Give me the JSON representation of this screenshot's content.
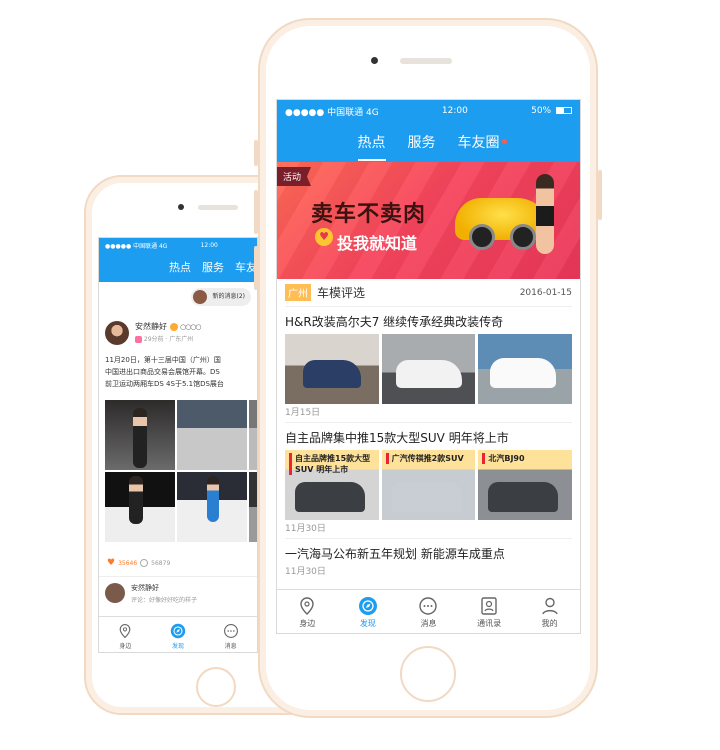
{
  "front": {
    "status": {
      "carrier": "●●●●● 中国联通 4G",
      "time": "12:00",
      "battery": "50%"
    },
    "nav": {
      "tabs": [
        "热点",
        "服务",
        "车友圈"
      ]
    },
    "banner": {
      "tag": "活动",
      "title": "卖车不卖肉",
      "subtitle": "投我就知道"
    },
    "section": {
      "tag": "广州",
      "title": "车模评选",
      "date": "2016-01-15"
    },
    "articles": [
      {
        "title": "H&R改装高尔夫7 继续传承经典改装传奇",
        "date": "1月15日",
        "captions": [
          "",
          "",
          ""
        ]
      },
      {
        "title": "自主品牌集中推15款大型SUV 明年将上市",
        "date": "11月30日",
        "captions": [
          "自主品牌推15款大型SUV 明年上市",
          "广汽传祺推2款SUV",
          "北汽BJ90"
        ]
      },
      {
        "title": "一汽海马公布新五年规划 新能源车成重点",
        "date": "11月30日"
      }
    ],
    "tabbar": [
      "身边",
      "发现",
      "消息",
      "通讯录",
      "我的"
    ]
  },
  "back": {
    "status": {
      "carrier": "●●●●● 中国联通 4G",
      "time": "12:00"
    },
    "nav": {
      "tabs": [
        "热点",
        "服务",
        "车友"
      ]
    },
    "message_pill": "新的消息(2)",
    "post": {
      "user": "安然静好",
      "meta": "29分前 · 广东广州",
      "text_lines": [
        "11月20日，第十三届中国（广州）国",
        "中国进出口商品交易会展馆开幕。DS",
        "前卫运动两厢车DS 4S于5.1馆DS展台"
      ],
      "likes": "35646",
      "comments": "56879"
    },
    "comment": {
      "name": "安然静好",
      "text": "评论：好像好好吃的样子"
    },
    "tabbar": [
      "身边",
      "发现",
      "消息"
    ]
  },
  "colors": {
    "brand_blue": "#1d9df0",
    "phone_frame": "#f1d9c3",
    "banner_red": "#f6455c"
  }
}
